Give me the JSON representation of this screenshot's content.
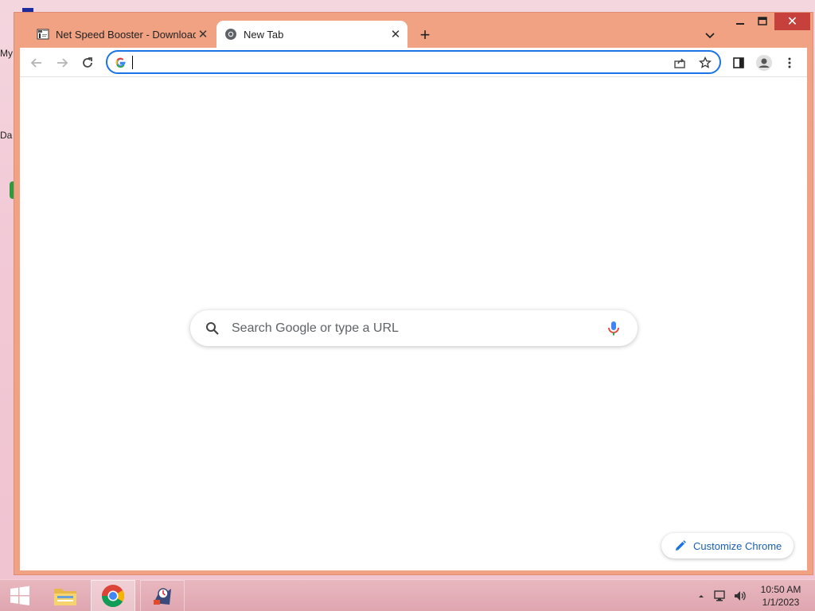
{
  "desktop": {
    "fragment_1": "My",
    "fragment_2": "Da"
  },
  "tabs": [
    {
      "title": "Net Speed Booster - Download",
      "active": false,
      "close": "✕"
    },
    {
      "title": "New Tab",
      "active": true,
      "close": "✕"
    }
  ],
  "tabstrip": {
    "new_tab": "+"
  },
  "window_controls": {
    "minimize": "—",
    "maximize": "☐",
    "close": "✕"
  },
  "toolbar": {
    "back_icon": "back-arrow-icon",
    "forward_icon": "forward-arrow-icon",
    "reload_icon": "reload-icon",
    "address_value": "",
    "share_icon": "share-icon",
    "bookmark_icon": "star-icon",
    "side_panel_icon": "side-panel-icon",
    "profile_icon": "avatar-icon",
    "menu_icon": "kebab-menu-icon"
  },
  "ntp": {
    "search_placeholder": "Search Google or type a URL",
    "customize_label": "Customize Chrome"
  },
  "taskbar": {
    "items": [
      "start-button",
      "file-explorer",
      "chrome",
      "app"
    ],
    "time": "10:50 AM",
    "date": "1/1/2023"
  },
  "colors": {
    "window_frame": "#f0a283",
    "accent_blue": "#1a73e8",
    "close_red": "#c6413c"
  }
}
